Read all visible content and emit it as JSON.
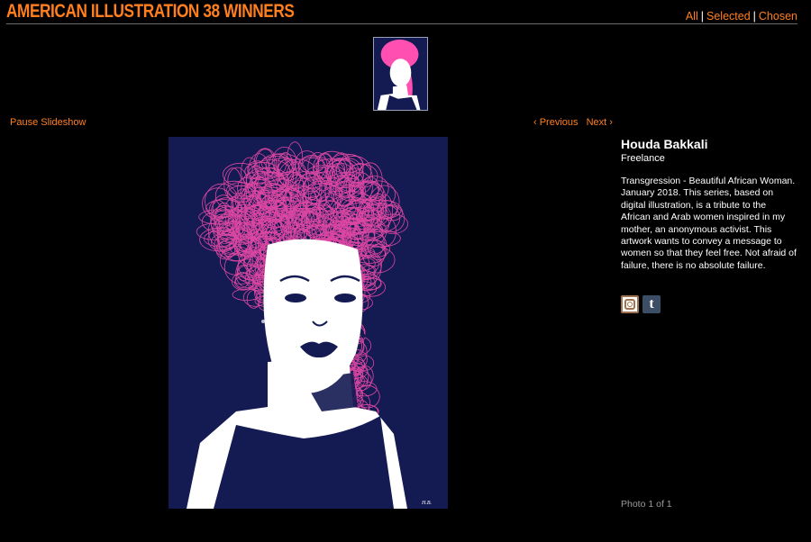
{
  "site": {
    "title": "AMERICAN ILLUSTRATION 38 WINNERS",
    "accent_color": "#ff7f1f"
  },
  "filters": {
    "all": "All",
    "selected": "Selected",
    "chosen": "Chosen",
    "separator": "|"
  },
  "slideshow": {
    "pause_label": "Pause Slideshow",
    "previous_label": "‹ Previous",
    "next_label": "Next ›",
    "photo_count": "Photo 1 of 1"
  },
  "entry": {
    "artist": "Houda Bakkali",
    "affiliation": "Freelance",
    "description": "Transgression - Beautiful African Woman. January 2018. This series, based on digital illustration, is a tribute to the African and Arab women inspired in my mother, an anonymous activist. This artwork wants to convey a message to women so that they feel free. Not afraid of failure, there is no absolute failure."
  },
  "social": [
    {
      "icon": "instagram-icon"
    },
    {
      "icon": "tumblr-icon",
      "glyph": "t"
    }
  ],
  "artwork_colors": {
    "background": "#141a52",
    "hair": "#ff4fb0",
    "skin": "#ffffff"
  }
}
